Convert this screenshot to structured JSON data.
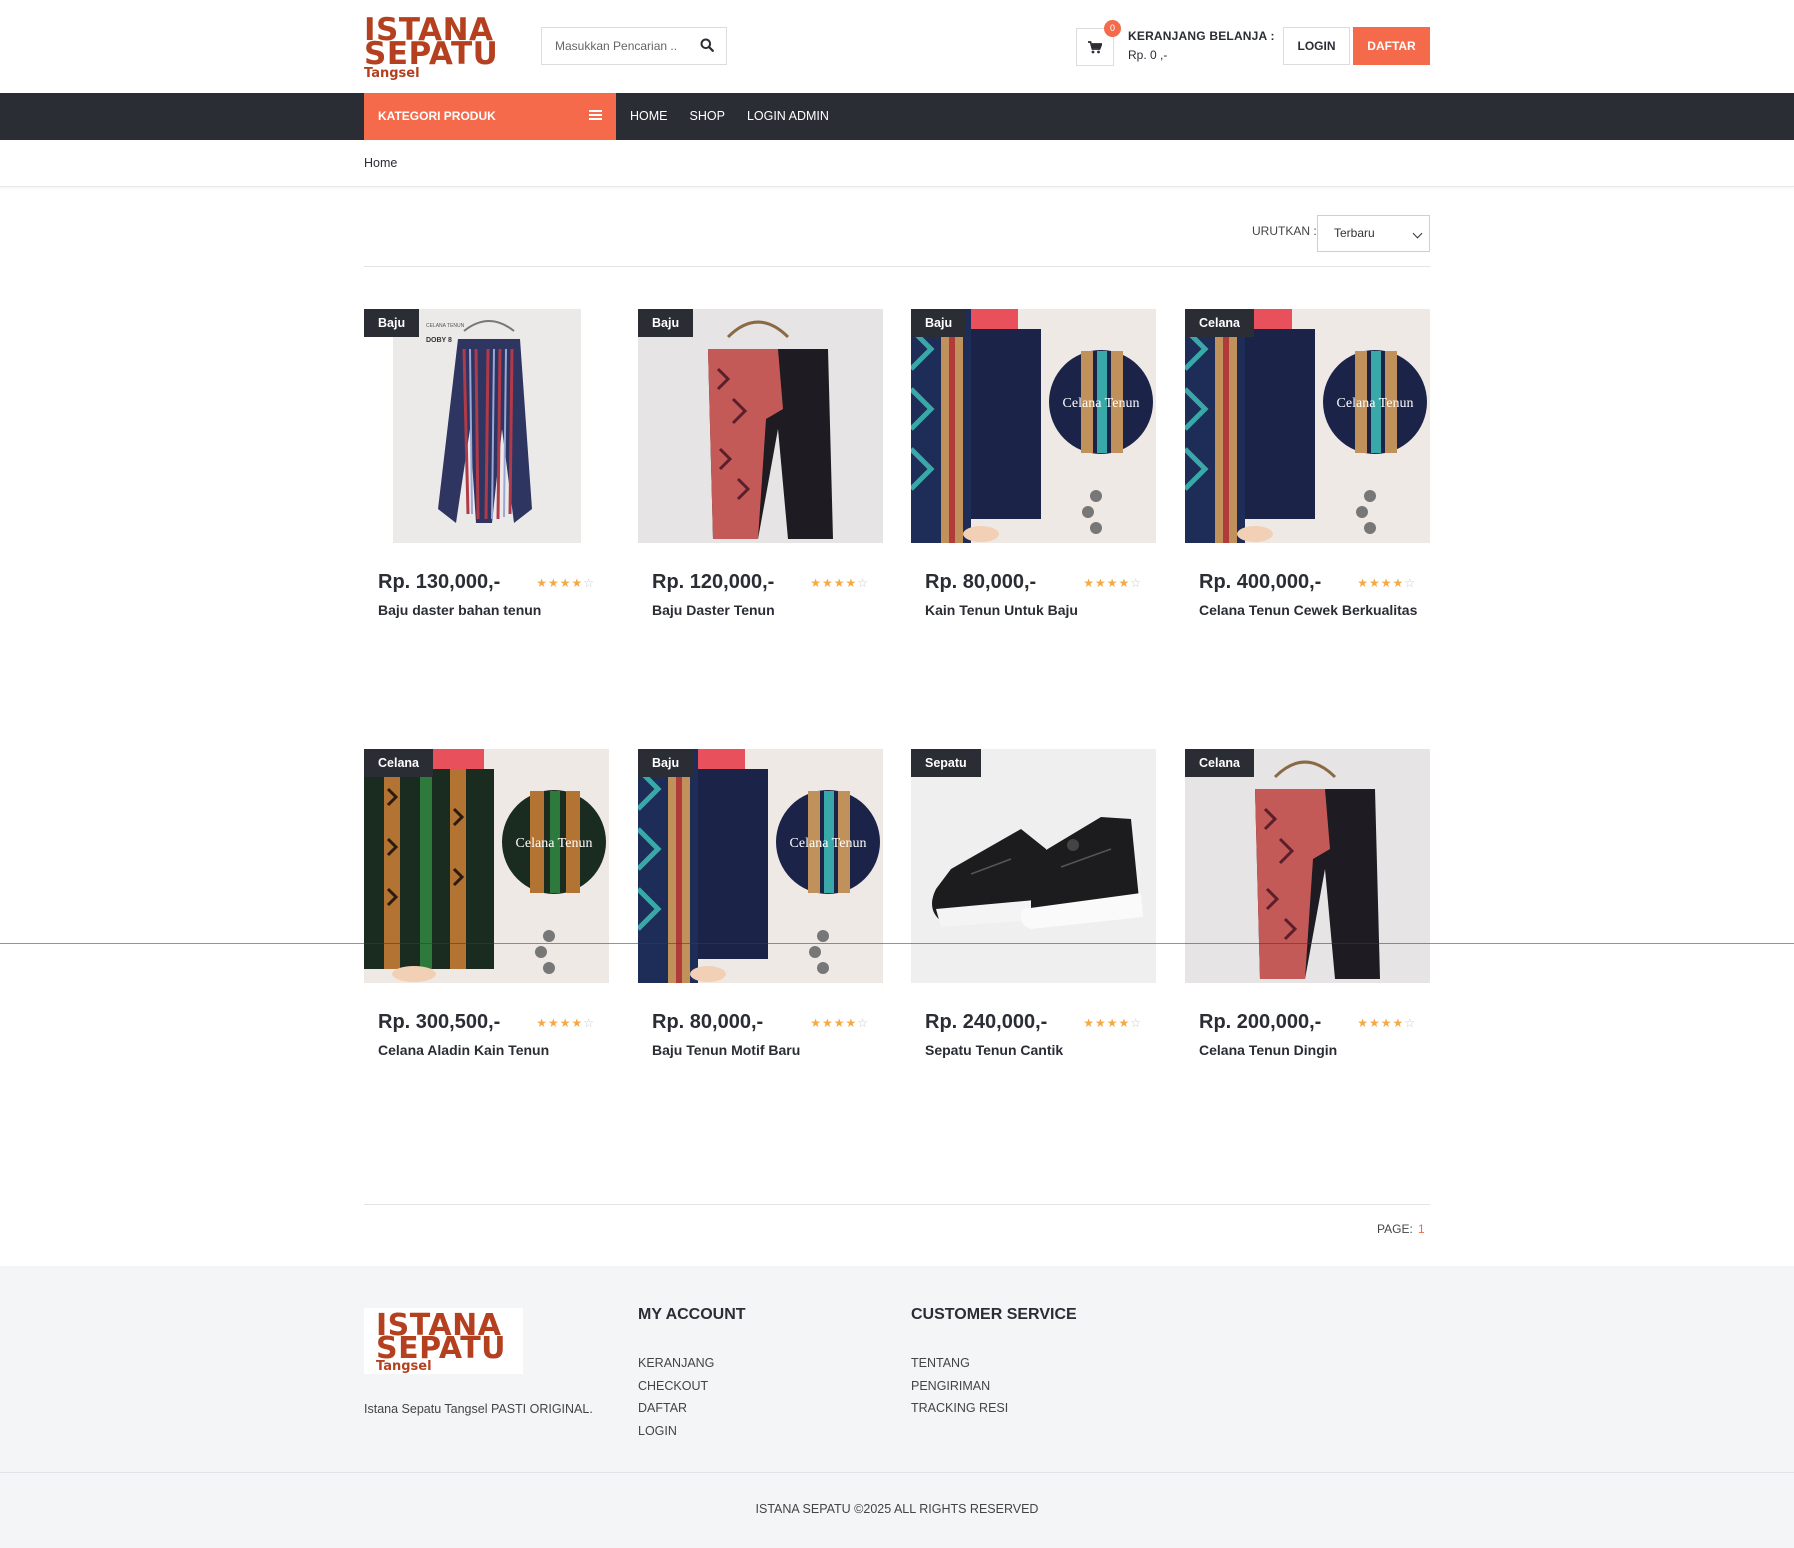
{
  "header": {
    "logo": {
      "line1": "ISTANA",
      "line2": "SEPATU",
      "line3": "Tangsel"
    },
    "search_placeholder": "Masukkan Pencarian ..",
    "cart": {
      "badge": "0",
      "title": "KERANJANG BELANJA :",
      "total": "Rp. 0 ,-"
    },
    "login_label": "LOGIN",
    "register_label": "DAFTAR"
  },
  "nav": {
    "category_label": "KATEGORI PRODUK",
    "links": [
      "HOME",
      "SHOP",
      "LOGIN ADMIN"
    ]
  },
  "breadcrumb": {
    "current": "Home"
  },
  "sort": {
    "label": "URUTKAN :",
    "selected": "Terbaru"
  },
  "products": [
    {
      "tag": "Baju",
      "price": "Rp. 130,000,-",
      "name": "Baju daster bahan tenun",
      "rating": 4,
      "image": "striped-pants-on-hanger"
    },
    {
      "tag": "Baju",
      "price": "Rp. 120,000,-",
      "name": "Baju Daster Tenun",
      "rating": 4,
      "image": "patterned-pants-on-hanger"
    },
    {
      "tag": "Baju",
      "price": "Rp. 80,000,-",
      "name": "Kain Tenun Untuk Baju",
      "rating": 4,
      "image": "tenun-pants-teal"
    },
    {
      "tag": "Celana",
      "price": "Rp. 400,000,-",
      "name": "Celana Tenun Cewek Berkualitas",
      "rating": 4,
      "image": "tenun-pants-teal"
    },
    {
      "tag": "Celana",
      "price": "Rp. 300,500,-",
      "name": "Celana Aladin Kain Tenun",
      "rating": 4,
      "image": "tenun-pants-green"
    },
    {
      "tag": "Baju",
      "price": "Rp. 80,000,-",
      "name": "Baju Tenun Motif Baru",
      "rating": 4,
      "image": "tenun-pants-teal"
    },
    {
      "tag": "Sepatu",
      "price": "Rp. 240,000,-",
      "name": "Sepatu Tenun Cantik",
      "rating": 4,
      "image": "black-sneakers"
    },
    {
      "tag": "Celana",
      "price": "Rp. 200,000,-",
      "name": "Celana Tenun Dingin",
      "rating": 4,
      "image": "patterned-pants-on-hanger"
    }
  ],
  "image_texts": {
    "circle_label": "Celana Tenun",
    "hanger_tag": "DOBY 8"
  },
  "pagination": {
    "label": "PAGE:",
    "current": "1"
  },
  "footer": {
    "logo": {
      "line1": "ISTANA",
      "line2": "SEPATU",
      "line3": "Tangsel"
    },
    "about": "Istana Sepatu Tangsel PASTI ORIGINAL.",
    "my_account": {
      "title": "MY ACCOUNT",
      "links": [
        "KERANJANG",
        "CHECKOUT",
        "DAFTAR",
        "LOGIN"
      ]
    },
    "customer_service": {
      "title": "CUSTOMER SERVICE",
      "links": [
        "TENTANG",
        "PENGIRIMAN",
        "TRACKING RESI"
      ]
    },
    "copyright": "ISTANA SEPATU ©2025 ALL RIGHTS RESERVED"
  },
  "colors": {
    "accent": "#f56a4a",
    "dark": "#2b2d35",
    "brand": "#b5401f",
    "star": "#f6a943"
  }
}
